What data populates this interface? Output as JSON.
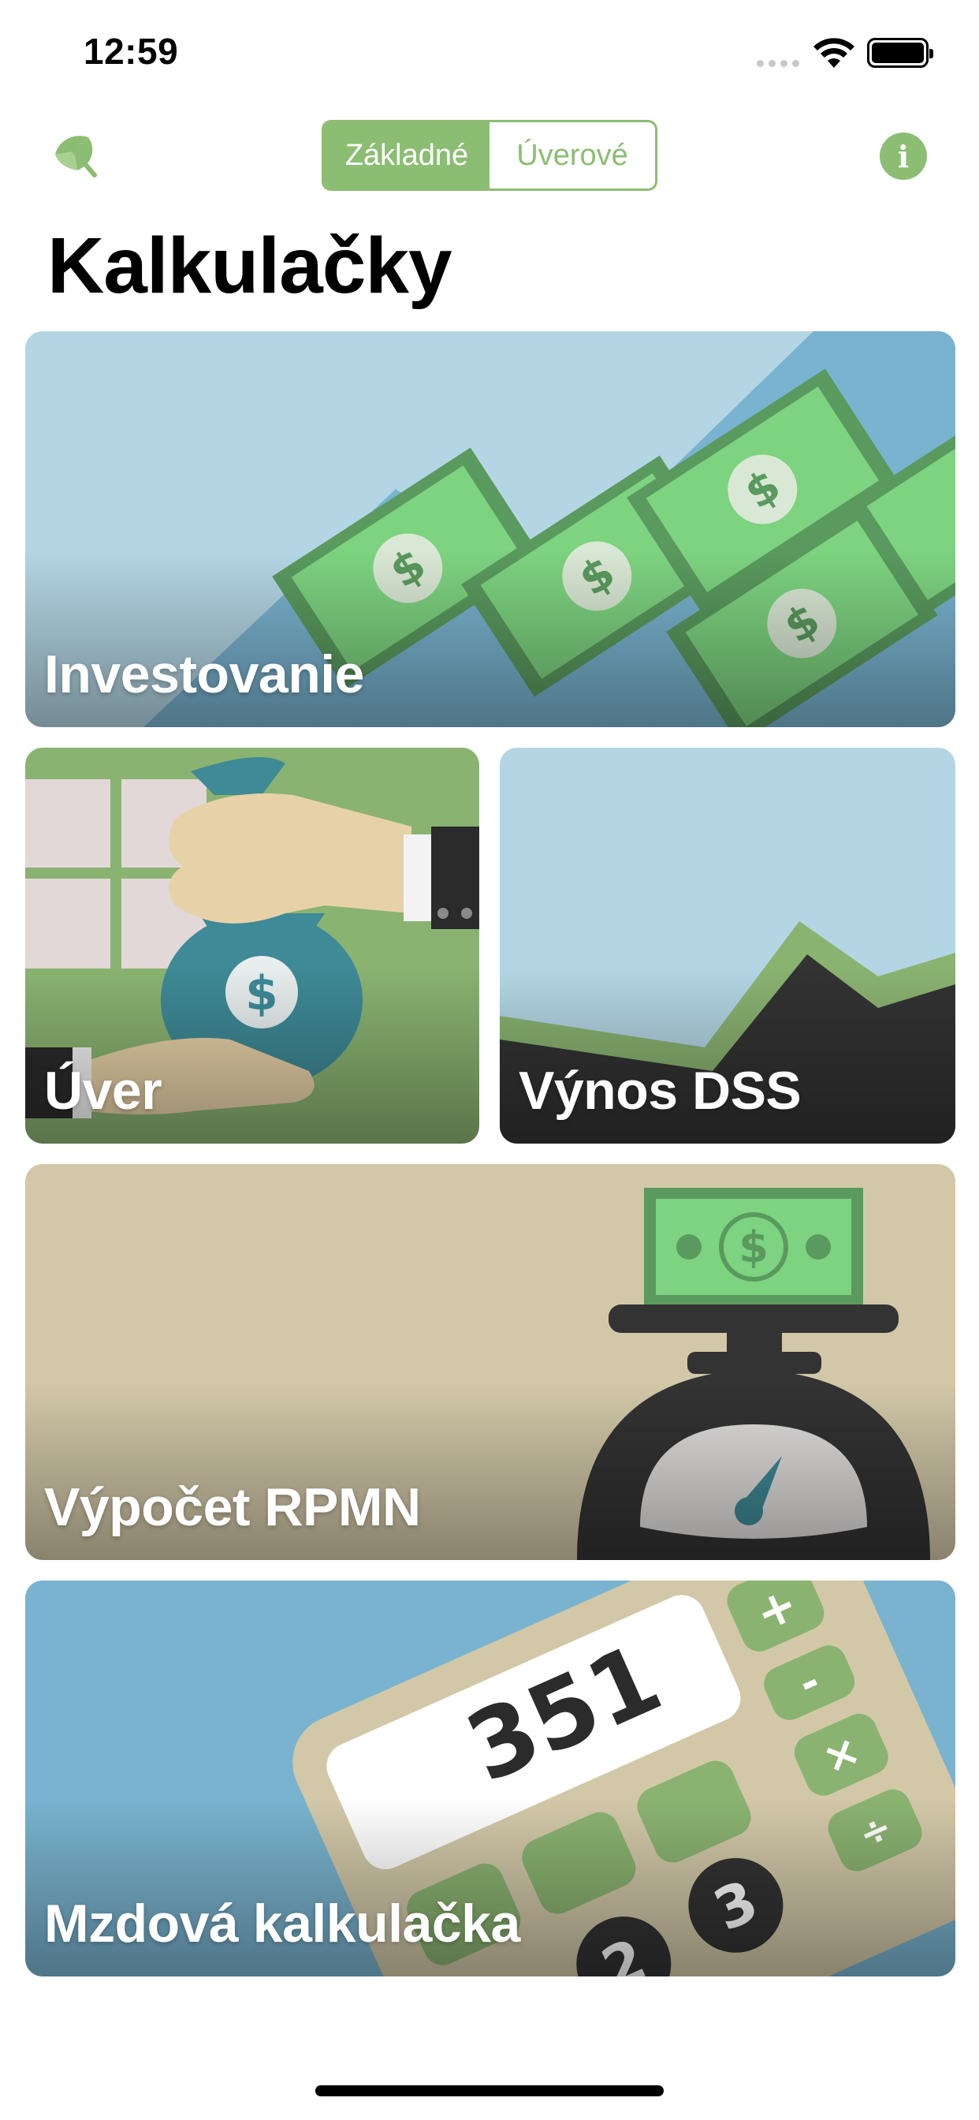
{
  "status_bar": {
    "time": "12:59"
  },
  "nav": {
    "segments": [
      {
        "label": "Základné",
        "active": true
      },
      {
        "label": "Úverové",
        "active": false
      }
    ],
    "info_label": "i"
  },
  "page_title": "Kalkulačky",
  "cards": {
    "investovanie": "Investovanie",
    "uver": "Úver",
    "vynos_dss": "Výnos DSS",
    "rpmn": "Výpočet RPMN",
    "mzdova": "Mzdová kalkulačka"
  },
  "calculator_display": "351",
  "calculator_keys": [
    "+",
    "-",
    "×",
    "÷",
    "3",
    "2"
  ],
  "theme": {
    "accent": "#8bbd72",
    "money_green": "#7dd380"
  }
}
